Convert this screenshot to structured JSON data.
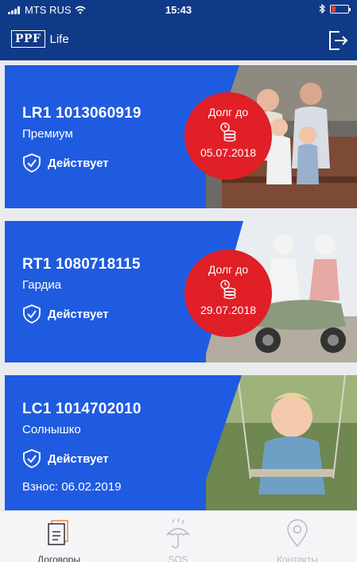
{
  "status_bar": {
    "carrier": "MTS RUS",
    "time": "15:43"
  },
  "header": {
    "logo_box": "PPF",
    "logo_text": "Life"
  },
  "contracts": [
    {
      "number": "LR1 1013060919",
      "plan": "Премиум",
      "status": "Действует",
      "debt_label": "Долг до",
      "debt_date": "05.07.2018"
    },
    {
      "number": "RT1 1080718115",
      "plan": "Гардиа",
      "status": "Действует",
      "debt_label": "Долг до",
      "debt_date": "29.07.2018"
    },
    {
      "number": "LC1 1014702010",
      "plan": "Солнышко",
      "status": "Действует",
      "fee": "Взнос: 06.02.2019"
    }
  ],
  "tabs": [
    {
      "label": "Договоры",
      "active": true
    },
    {
      "label": "SOS",
      "active": false
    },
    {
      "label": "Контакты",
      "active": false
    }
  ],
  "colors": {
    "header": "#0f3a87",
    "card": "#1f5be0",
    "debt": "#e01f27"
  }
}
